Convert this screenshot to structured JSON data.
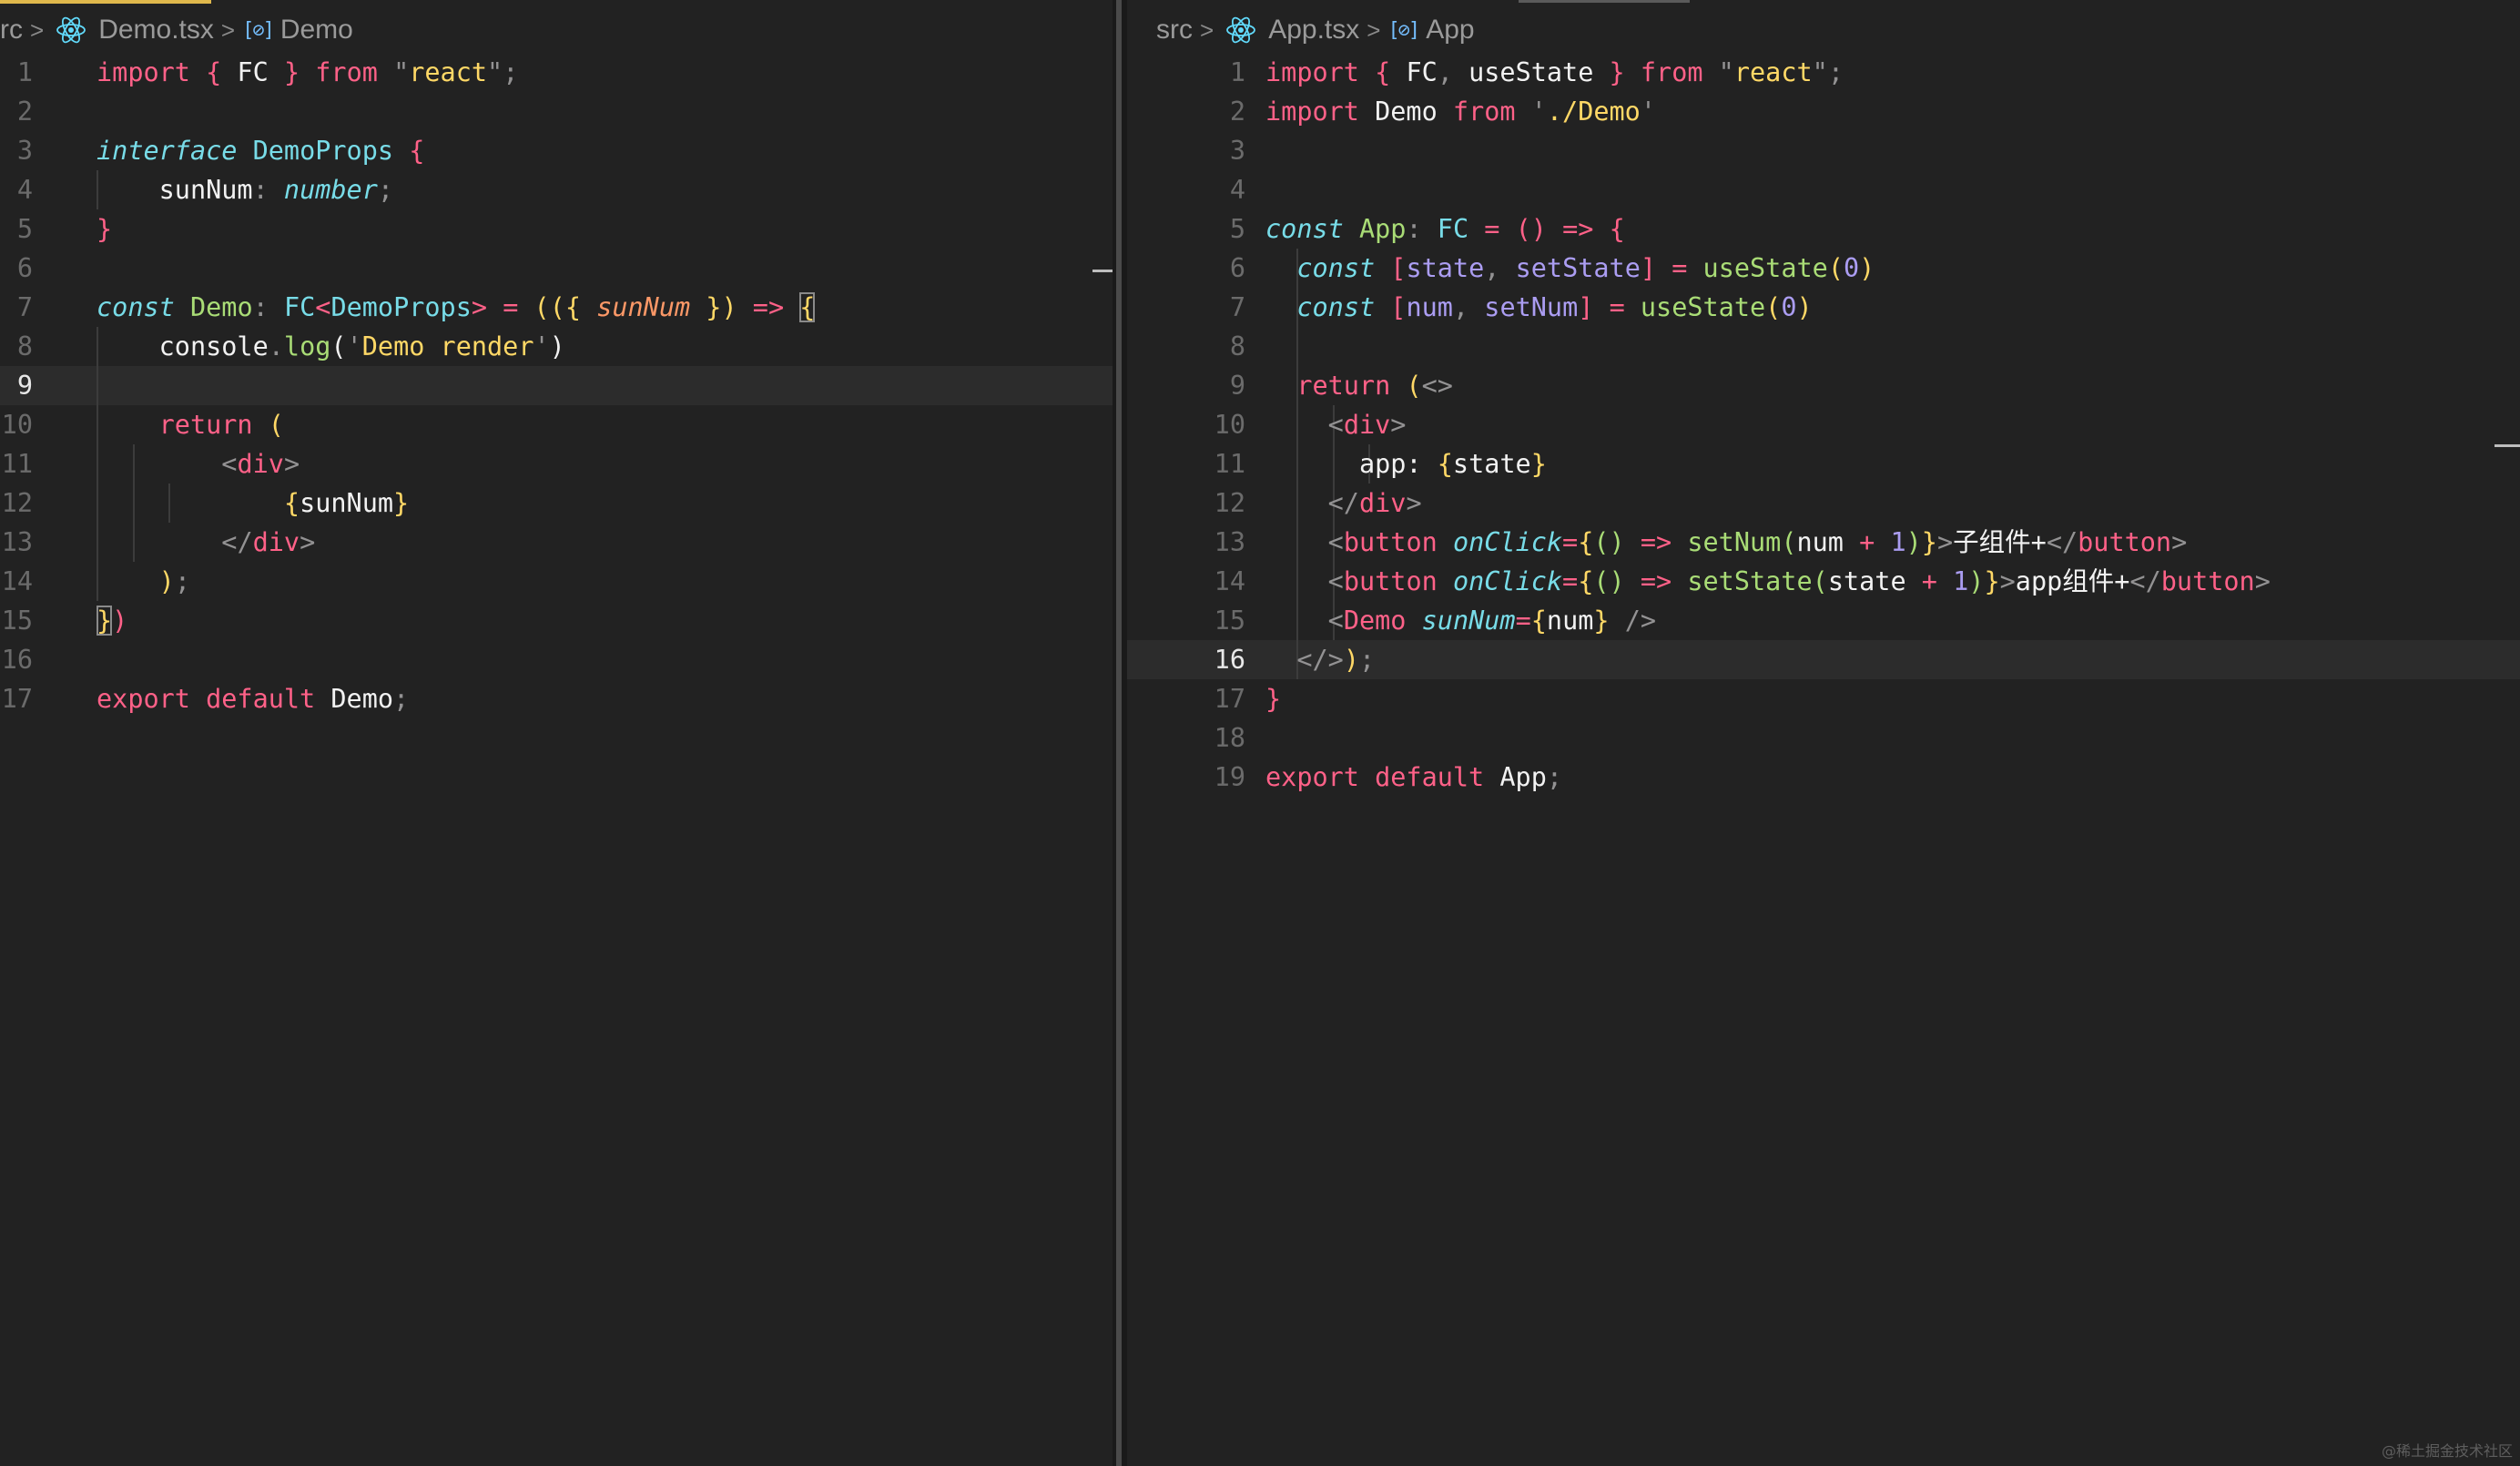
{
  "left_editor": {
    "breadcrumb": {
      "folder": "rc",
      "file": "Demo.tsx",
      "symbol": "Demo"
    },
    "current_line": 9,
    "lines": [
      {
        "n": "1",
        "tokens": [
          {
            "t": "import",
            "c": "k"
          },
          {
            "t": " ",
            "c": "v"
          },
          {
            "t": "{",
            "c": "k"
          },
          {
            "t": " FC ",
            "c": "v"
          },
          {
            "t": "}",
            "c": "k"
          },
          {
            "t": " from ",
            "c": "k"
          },
          {
            "t": "\"",
            "c": "p"
          },
          {
            "t": "react",
            "c": "s"
          },
          {
            "t": "\"",
            "c": "p"
          },
          {
            "t": ";",
            "c": "p"
          }
        ]
      },
      {
        "n": "2",
        "tokens": []
      },
      {
        "n": "3",
        "tokens": [
          {
            "t": "interface",
            "c": "kc"
          },
          {
            "t": " ",
            "c": "v"
          },
          {
            "t": "DemoProps",
            "c": "t"
          },
          {
            "t": " ",
            "c": "v"
          },
          {
            "t": "{",
            "c": "k"
          }
        ]
      },
      {
        "n": "4",
        "tokens": [
          {
            "t": "    sunNum",
            "c": "v"
          },
          {
            "t": ": ",
            "c": "p"
          },
          {
            "t": "number",
            "c": "ti"
          },
          {
            "t": ";",
            "c": "p"
          }
        ]
      },
      {
        "n": "5",
        "tokens": [
          {
            "t": "}",
            "c": "k"
          }
        ]
      },
      {
        "n": "6",
        "tokens": []
      },
      {
        "n": "7",
        "tokens": [
          {
            "t": "const",
            "c": "kc"
          },
          {
            "t": " ",
            "c": "v"
          },
          {
            "t": "Demo",
            "c": "f"
          },
          {
            "t": ": ",
            "c": "p"
          },
          {
            "t": "FC",
            "c": "t"
          },
          {
            "t": "<",
            "c": "k"
          },
          {
            "t": "DemoProps",
            "c": "t"
          },
          {
            "t": ">",
            "c": "k"
          },
          {
            "t": " = ",
            "c": "k"
          },
          {
            "t": "((",
            "c": "br"
          },
          {
            "t": "{ ",
            "c": "br"
          },
          {
            "t": "sunNum",
            "c": "pm"
          },
          {
            "t": " })",
            "c": "br"
          },
          {
            "t": " => ",
            "c": "k"
          },
          {
            "t": "{",
            "c": "br bo"
          }
        ]
      },
      {
        "n": "8",
        "tokens": [
          {
            "t": "    console",
            "c": "v"
          },
          {
            "t": ".",
            "c": "p"
          },
          {
            "t": "log",
            "c": "f"
          },
          {
            "t": "(",
            "c": "v"
          },
          {
            "t": "'",
            "c": "p"
          },
          {
            "t": "Demo render",
            "c": "s"
          },
          {
            "t": "'",
            "c": "p"
          },
          {
            "t": ")",
            "c": "v"
          }
        ]
      },
      {
        "n": "9",
        "tokens": []
      },
      {
        "n": "10",
        "tokens": [
          {
            "t": "    return",
            "c": "k"
          },
          {
            "t": " (",
            "c": "br"
          }
        ]
      },
      {
        "n": "11",
        "tokens": [
          {
            "t": "        ",
            "c": "v"
          },
          {
            "t": "<",
            "c": "p"
          },
          {
            "t": "div",
            "c": "tag"
          },
          {
            "t": ">",
            "c": "p"
          }
        ]
      },
      {
        "n": "12",
        "tokens": [
          {
            "t": "            ",
            "c": "v"
          },
          {
            "t": "{",
            "c": "br"
          },
          {
            "t": "sunNum",
            "c": "v"
          },
          {
            "t": "}",
            "c": "br"
          }
        ]
      },
      {
        "n": "13",
        "tokens": [
          {
            "t": "        ",
            "c": "v"
          },
          {
            "t": "</",
            "c": "p"
          },
          {
            "t": "div",
            "c": "tag"
          },
          {
            "t": ">",
            "c": "p"
          }
        ]
      },
      {
        "n": "14",
        "tokens": [
          {
            "t": "    ",
            "c": "v"
          },
          {
            "t": ")",
            "c": "br"
          },
          {
            "t": ";",
            "c": "p"
          }
        ]
      },
      {
        "n": "15",
        "tokens": [
          {
            "t": "}",
            "c": "br bo"
          },
          {
            "t": ")",
            "c": "k"
          }
        ]
      },
      {
        "n": "16",
        "tokens": []
      },
      {
        "n": "17",
        "tokens": [
          {
            "t": "export",
            "c": "k"
          },
          {
            "t": " default ",
            "c": "k"
          },
          {
            "t": "Demo",
            "c": "v"
          },
          {
            "t": ";",
            "c": "p"
          }
        ]
      }
    ]
  },
  "right_editor": {
    "breadcrumb": {
      "folder": "src",
      "file": "App.tsx",
      "symbol": "App"
    },
    "current_line": 16,
    "lines": [
      {
        "n": "1",
        "tokens": [
          {
            "t": "import",
            "c": "k"
          },
          {
            "t": " ",
            "c": "v"
          },
          {
            "t": "{",
            "c": "k"
          },
          {
            "t": " FC",
            "c": "v"
          },
          {
            "t": ", ",
            "c": "p"
          },
          {
            "t": "useState ",
            "c": "v"
          },
          {
            "t": "}",
            "c": "k"
          },
          {
            "t": " from ",
            "c": "k"
          },
          {
            "t": "\"",
            "c": "p"
          },
          {
            "t": "react",
            "c": "s"
          },
          {
            "t": "\"",
            "c": "p"
          },
          {
            "t": ";",
            "c": "p"
          }
        ]
      },
      {
        "n": "2",
        "tokens": [
          {
            "t": "import",
            "c": "k"
          },
          {
            "t": " Demo ",
            "c": "v"
          },
          {
            "t": "from",
            "c": "k"
          },
          {
            "t": " ",
            "c": "v"
          },
          {
            "t": "'",
            "c": "p"
          },
          {
            "t": "./Demo",
            "c": "s"
          },
          {
            "t": "'",
            "c": "p"
          }
        ]
      },
      {
        "n": "3",
        "tokens": []
      },
      {
        "n": "4",
        "tokens": []
      },
      {
        "n": "5",
        "tokens": [
          {
            "t": "const",
            "c": "kc"
          },
          {
            "t": " ",
            "c": "v"
          },
          {
            "t": "App",
            "c": "f"
          },
          {
            "t": ": ",
            "c": "p"
          },
          {
            "t": "FC",
            "c": "t"
          },
          {
            "t": " = ",
            "c": "k"
          },
          {
            "t": "()",
            "c": "k"
          },
          {
            "t": " => ",
            "c": "k"
          },
          {
            "t": "{",
            "c": "k"
          }
        ]
      },
      {
        "n": "6",
        "tokens": [
          {
            "t": "  ",
            "c": "v"
          },
          {
            "t": "const",
            "c": "kc"
          },
          {
            "t": " ",
            "c": "v"
          },
          {
            "t": "[",
            "c": "k"
          },
          {
            "t": "state",
            "c": "n"
          },
          {
            "t": ", ",
            "c": "p"
          },
          {
            "t": "setState",
            "c": "n"
          },
          {
            "t": "]",
            "c": "k"
          },
          {
            "t": " = ",
            "c": "k"
          },
          {
            "t": "useState",
            "c": "f"
          },
          {
            "t": "(",
            "c": "br"
          },
          {
            "t": "0",
            "c": "n"
          },
          {
            "t": ")",
            "c": "br"
          }
        ]
      },
      {
        "n": "7",
        "tokens": [
          {
            "t": "  ",
            "c": "v"
          },
          {
            "t": "const",
            "c": "kc"
          },
          {
            "t": " ",
            "c": "v"
          },
          {
            "t": "[",
            "c": "k"
          },
          {
            "t": "num",
            "c": "n"
          },
          {
            "t": ", ",
            "c": "p"
          },
          {
            "t": "setNum",
            "c": "n"
          },
          {
            "t": "]",
            "c": "k"
          },
          {
            "t": " = ",
            "c": "k"
          },
          {
            "t": "useState",
            "c": "f"
          },
          {
            "t": "(",
            "c": "br"
          },
          {
            "t": "0",
            "c": "n"
          },
          {
            "t": ")",
            "c": "br"
          }
        ]
      },
      {
        "n": "8",
        "tokens": []
      },
      {
        "n": "9",
        "tokens": [
          {
            "t": "  ",
            "c": "v"
          },
          {
            "t": "return",
            "c": "k"
          },
          {
            "t": " (",
            "c": "br"
          },
          {
            "t": "<>",
            "c": "p"
          }
        ]
      },
      {
        "n": "10",
        "tokens": [
          {
            "t": "    ",
            "c": "v"
          },
          {
            "t": "<",
            "c": "p"
          },
          {
            "t": "div",
            "c": "tag"
          },
          {
            "t": ">",
            "c": "p"
          }
        ]
      },
      {
        "n": "11",
        "tokens": [
          {
            "t": "      app: ",
            "c": "v"
          },
          {
            "t": "{",
            "c": "br"
          },
          {
            "t": "state",
            "c": "v"
          },
          {
            "t": "}",
            "c": "br"
          }
        ]
      },
      {
        "n": "12",
        "tokens": [
          {
            "t": "    ",
            "c": "v"
          },
          {
            "t": "</",
            "c": "p"
          },
          {
            "t": "div",
            "c": "tag"
          },
          {
            "t": ">",
            "c": "p"
          }
        ]
      },
      {
        "n": "13",
        "tokens": [
          {
            "t": "    ",
            "c": "v"
          },
          {
            "t": "<",
            "c": "p"
          },
          {
            "t": "button",
            "c": "tag"
          },
          {
            "t": " ",
            "c": "v"
          },
          {
            "t": "onClick",
            "c": "ti"
          },
          {
            "t": "=",
            "c": "k"
          },
          {
            "t": "{",
            "c": "br"
          },
          {
            "t": "()",
            "c": "f"
          },
          {
            "t": " => ",
            "c": "k"
          },
          {
            "t": "setNum",
            "c": "f"
          },
          {
            "t": "(",
            "c": "f"
          },
          {
            "t": "num",
            "c": "v"
          },
          {
            "t": " + ",
            "c": "k"
          },
          {
            "t": "1",
            "c": "n"
          },
          {
            "t": ")",
            "c": "f"
          },
          {
            "t": "}",
            "c": "br"
          },
          {
            "t": ">",
            "c": "p"
          },
          {
            "t": "子组件+",
            "c": "v"
          },
          {
            "t": "</",
            "c": "p"
          },
          {
            "t": "button",
            "c": "tag"
          },
          {
            "t": ">",
            "c": "p"
          }
        ]
      },
      {
        "n": "14",
        "tokens": [
          {
            "t": "    ",
            "c": "v"
          },
          {
            "t": "<",
            "c": "p"
          },
          {
            "t": "button",
            "c": "tag"
          },
          {
            "t": " ",
            "c": "v"
          },
          {
            "t": "onClick",
            "c": "ti"
          },
          {
            "t": "=",
            "c": "k"
          },
          {
            "t": "{",
            "c": "br"
          },
          {
            "t": "()",
            "c": "f"
          },
          {
            "t": " => ",
            "c": "k"
          },
          {
            "t": "setState",
            "c": "f"
          },
          {
            "t": "(",
            "c": "f"
          },
          {
            "t": "state",
            "c": "v"
          },
          {
            "t": " + ",
            "c": "k"
          },
          {
            "t": "1",
            "c": "n"
          },
          {
            "t": ")",
            "c": "f"
          },
          {
            "t": "}",
            "c": "br"
          },
          {
            "t": ">",
            "c": "p"
          },
          {
            "t": "app组件+",
            "c": "v"
          },
          {
            "t": "</",
            "c": "p"
          },
          {
            "t": "button",
            "c": "tag"
          },
          {
            "t": ">",
            "c": "p"
          }
        ]
      },
      {
        "n": "15",
        "tokens": [
          {
            "t": "    ",
            "c": "v"
          },
          {
            "t": "<",
            "c": "p"
          },
          {
            "t": "Demo",
            "c": "tag"
          },
          {
            "t": " ",
            "c": "v"
          },
          {
            "t": "sunNum",
            "c": "ti"
          },
          {
            "t": "=",
            "c": "k"
          },
          {
            "t": "{",
            "c": "br"
          },
          {
            "t": "num",
            "c": "v"
          },
          {
            "t": "}",
            "c": "br"
          },
          {
            "t": " />",
            "c": "p"
          }
        ]
      },
      {
        "n": "16",
        "tokens": [
          {
            "t": "  ",
            "c": "v"
          },
          {
            "t": "</>",
            "c": "p"
          },
          {
            "t": ")",
            "c": "br"
          },
          {
            "t": ";",
            "c": "p"
          }
        ]
      },
      {
        "n": "17",
        "tokens": [
          {
            "t": "}",
            "c": "k"
          }
        ]
      },
      {
        "n": "18",
        "tokens": []
      },
      {
        "n": "19",
        "tokens": [
          {
            "t": "export",
            "c": "k"
          },
          {
            "t": " default ",
            "c": "k"
          },
          {
            "t": "App",
            "c": "v"
          },
          {
            "t": ";",
            "c": "p"
          }
        ]
      }
    ]
  },
  "watermark": "@稀土掘金技术社区"
}
